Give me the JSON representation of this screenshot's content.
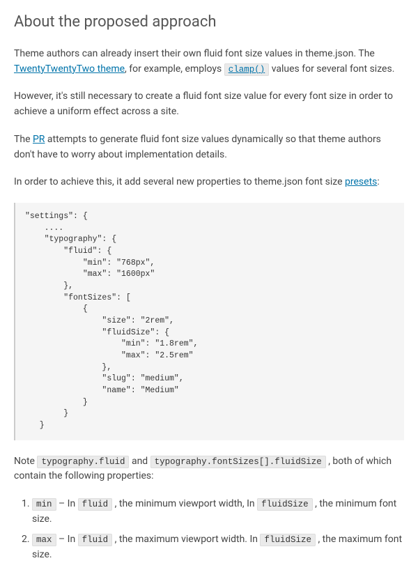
{
  "title": "About the proposed approach",
  "para1": {
    "text1": "Theme authors can already insert their own fluid font size values in theme.json. The ",
    "link1": "TwentyTwentyTwo theme",
    "text2": ", for example, employs ",
    "code1": "clamp()",
    "text3": " values for several font sizes."
  },
  "para2": "However, it's still necessary to create a fluid font size value for every font size in order to achieve a uniform effect across a site.",
  "para3": {
    "text1": "The ",
    "link1": "PR",
    "text2": " attempts to generate fluid font size values dynamically so that theme authors don't have to worry about implementation details."
  },
  "para4": {
    "text1": "In order to achieve this, it add several new properties to theme.json font size ",
    "link1": "presets",
    "text2": ":"
  },
  "code_block": "\"settings\": {\n    ....\n    \"typography\": {\n        \"fluid\": {\n            \"min\": \"768px\",\n            \"max\": \"1600px\"\n        },\n        \"fontSizes\": [\n            {\n                \"size\": \"2rem\",\n                \"fluidSize\": {\n                    \"min\": \"1.8rem\",\n                    \"max\": \"2.5rem\"\n                },\n                \"slug\": \"medium\",\n                \"name\": \"Medium\"\n            }\n        }\n   }",
  "para5": {
    "text1": "Note ",
    "code1": "typography.fluid",
    "text2": " and ",
    "code2": "typography.fontSizes[].fluidSize",
    "text3": " , both of which contain the following properties:"
  },
  "list": {
    "item1": {
      "code1": "min",
      "text1": " – In ",
      "code2": "fluid",
      "text2": " , the minimum viewport width, In ",
      "code3": "fluidSize",
      "text3": " , the minimum font size."
    },
    "item2": {
      "code1": "max",
      "text1": " – In ",
      "code2": "fluid",
      "text2": " , the maximum viewport width. In ",
      "code3": "fluidSize",
      "text3": " , the maximum font size."
    }
  }
}
